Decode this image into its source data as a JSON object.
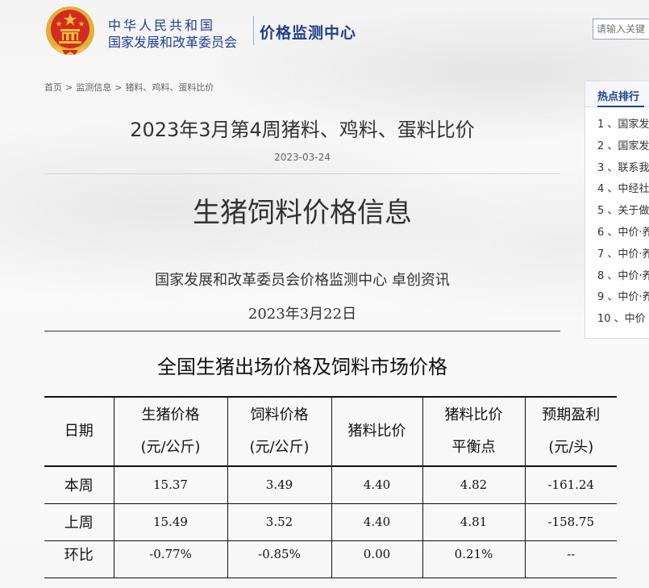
{
  "header": {
    "org_name": "中华人民共和国",
    "org_full": "国家发展和改革委员会",
    "center_name": "价格监测中心",
    "search_placeholder": "请输入关键"
  },
  "breadcrumb": [
    "首页",
    "监测信息",
    "猪料、鸡料、蛋料比价"
  ],
  "article": {
    "title": "2023年3月第4周猪料、鸡料、蛋料比价",
    "date": "2023-03-24"
  },
  "document": {
    "title": "生猪饲料价格信息",
    "source": "国家发展和改革委员会价格监测中心  卓创资讯",
    "date": "2023年3月22日",
    "table_title": "全国生猪出场价格及饲料市场价格"
  },
  "table": {
    "headers": [
      {
        "line1": "日期",
        "line2": ""
      },
      {
        "line1": "生猪价格",
        "line2": "(元/公斤)"
      },
      {
        "line1": "饲料价格",
        "line2": "(元/公斤)"
      },
      {
        "line1": "猪料比价",
        "line2": ""
      },
      {
        "line1": "猪料比价",
        "line2": "平衡点"
      },
      {
        "line1": "预期盈利",
        "line2": "(元/头)"
      }
    ],
    "rows": [
      [
        "本周",
        "15.37",
        "3.49",
        "4.40",
        "4.82",
        "-161.24"
      ],
      [
        "上周",
        "15.49",
        "3.52",
        "4.40",
        "4.81",
        "-158.75"
      ],
      [
        "环比",
        "-0.77%",
        "-0.85%",
        "0.00",
        "0.21%",
        "--"
      ]
    ]
  },
  "sidebar": {
    "title": "热点排行",
    "items": [
      "1 、国家发",
      "2 、国家发",
      "3 、联系我",
      "4 、中经社",
      "5 、关于做",
      "6 、中价·养",
      "7 、中价·养",
      "8 、中价·养",
      "9 、中价·养",
      "10 、中价"
    ]
  },
  "colors": {
    "brand_blue": "#1f3f8f",
    "emblem_red": "#d52b1e",
    "emblem_gold": "#f5c242"
  }
}
